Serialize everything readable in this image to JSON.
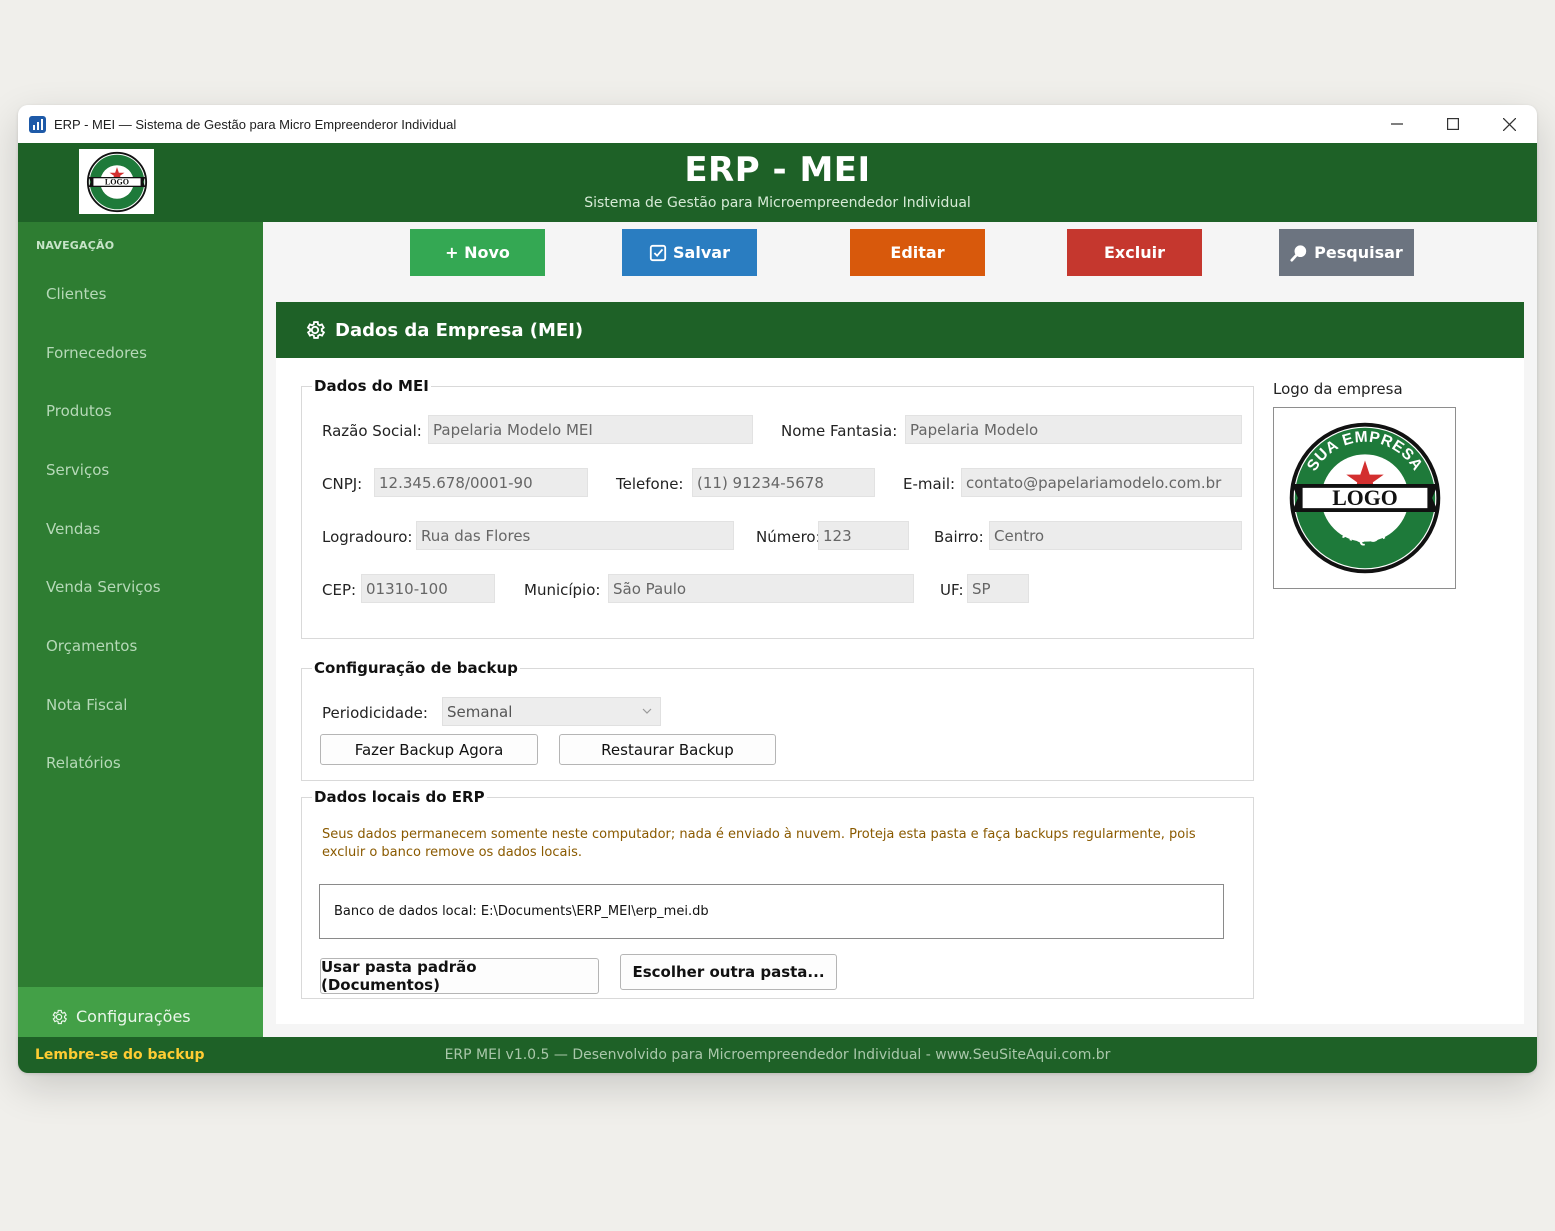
{
  "window": {
    "title": "ERP - MEI — Sistema de Gestão para Micro Empreenderor Individual"
  },
  "header": {
    "logo_text": "LOGO",
    "logo_ring_top": "SUA EMPRESA",
    "logo_ring_bottom": "AQUI",
    "title": "ERP - MEI",
    "subtitle": "Sistema de Gestão para Microempreendedor Individual"
  },
  "sidebar": {
    "heading": "NAVEGAÇÃO",
    "items": [
      {
        "label": "Clientes"
      },
      {
        "label": "Fornecedores"
      },
      {
        "label": "Produtos"
      },
      {
        "label": "Serviços"
      },
      {
        "label": "Vendas"
      },
      {
        "label": "Venda Serviços"
      },
      {
        "label": "Orçamentos"
      },
      {
        "label": "Nota Fiscal"
      },
      {
        "label": "Relatórios"
      }
    ],
    "active_item": "Configurações"
  },
  "toolbar": {
    "new": "+ Novo",
    "save": "Salvar",
    "edit": "Editar",
    "delete": "Excluir",
    "search": "Pesquisar",
    "colors": {
      "new": "#34a853",
      "save": "#2a7dc1",
      "edit": "#d8590c",
      "delete": "#c5372e",
      "search": "#6c7480"
    }
  },
  "section": {
    "title": "Dados da Empresa (MEI)"
  },
  "mei": {
    "legend": "Dados do MEI",
    "razao_social_label": "Razão Social:",
    "razao_social": "Papelaria Modelo MEI",
    "nome_fantasia_label": "Nome Fantasia:",
    "nome_fantasia": "Papelaria Modelo",
    "cnpj_label": "CNPJ:",
    "cnpj": "12.345.678/0001-90",
    "telefone_label": "Telefone:",
    "telefone": "(11) 91234-5678",
    "email_label": "E-mail:",
    "email": "contato@papelariamodelo.com.br",
    "logradouro_label": "Logradouro:",
    "logradouro": "Rua das Flores",
    "numero_label": "Número:",
    "numero": "123",
    "bairro_label": "Bairro:",
    "bairro": "Centro",
    "cep_label": "CEP:",
    "cep": "01310-100",
    "municipio_label": "Município:",
    "municipio": "São Paulo",
    "uf_label": "UF:",
    "uf": "SP"
  },
  "logo_panel": {
    "label": "Logo da empresa"
  },
  "backup": {
    "legend": "Configuração de backup",
    "periodicidade_label": "Periodicidade:",
    "periodicidade": "Semanal",
    "backup_now": "Fazer Backup Agora",
    "restore": "Restaurar Backup"
  },
  "local_data": {
    "legend": "Dados locais do ERP",
    "warning_line1": "Seus dados permanecem somente neste computador; nada é enviado à nuvem. Proteja esta pasta e faça backups regularmente, pois",
    "warning_line2": "excluir o banco remove os dados locais.",
    "db_path": "Banco de dados local: E:\\Documents\\ERP_MEI\\erp_mei.db",
    "default_folder": "Usar pasta padrão (Documentos)",
    "choose_folder": "Escolher outra pasta..."
  },
  "footer": {
    "reminder": "Lembre-se do backup",
    "info": "ERP MEI v1.0.5  —  Desenvolvido para Microempreendedor Individual  -  www.SeuSiteAqui.com.br"
  }
}
